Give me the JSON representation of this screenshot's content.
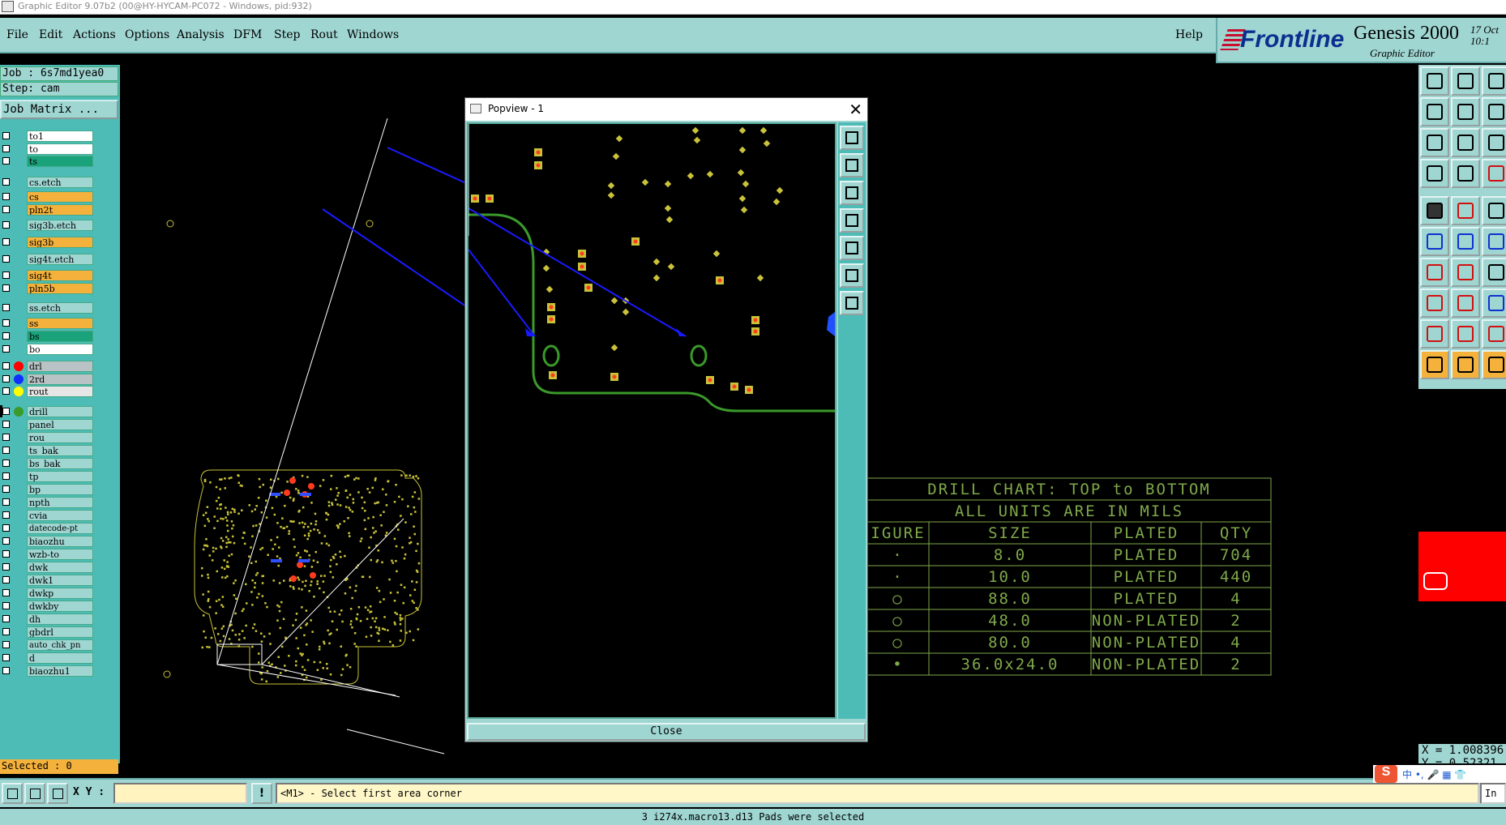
{
  "window_title": "Graphic Editor 9.07b2 (00@HY-HYCAM-PC072 - Windows, pid:932)",
  "menu": {
    "file": "File",
    "edit": "Edit",
    "actions": "Actions",
    "options": "Options",
    "analysis": "Analysis",
    "dfm": "DFM",
    "step": "Step",
    "rout": "Rout",
    "windows": "Windows",
    "help": "Help"
  },
  "brand": {
    "logo": "Frontline",
    "product": "Genesis 2000",
    "subtitle": "Graphic Editor",
    "date_line1": "17 Oct",
    "date_line2": "10:1"
  },
  "job": {
    "job_line": "Job : 6s7md1yea0",
    "step_line": "Step: cam",
    "job_matrix": "Job Matrix ..."
  },
  "layers": [
    {
      "name": "to1",
      "color": "#ffffff",
      "dot": ""
    },
    {
      "name": "to",
      "color": "#ffffff",
      "dot": ""
    },
    {
      "name": "ts",
      "color": "#1aa37a",
      "dot": ""
    },
    {
      "name": "cs.etch",
      "color": "#9fd6d2",
      "dot": ""
    },
    {
      "name": "cs",
      "color": "#f4b13c",
      "dot": ""
    },
    {
      "name": "pln2t",
      "color": "#f4b13c",
      "dot": ""
    },
    {
      "name": "sig3b.etch",
      "color": "#9fd6d2",
      "dot": ""
    },
    {
      "name": "sig3b",
      "color": "#f4b13c",
      "dot": ""
    },
    {
      "name": "sig4t.etch",
      "color": "#9fd6d2",
      "dot": ""
    },
    {
      "name": "sig4t",
      "color": "#f4b13c",
      "dot": ""
    },
    {
      "name": "pln5b",
      "color": "#f4b13c",
      "dot": ""
    },
    {
      "name": "ss.etch",
      "color": "#9fd6d2",
      "dot": ""
    },
    {
      "name": "ss",
      "color": "#f4b13c",
      "dot": ""
    },
    {
      "name": "bs",
      "color": "#1aa37a",
      "dot": ""
    },
    {
      "name": "bo",
      "color": "#ffffff",
      "dot": ""
    },
    {
      "name": "drl",
      "color": "#b9c3c5",
      "dot": "#ff0000"
    },
    {
      "name": "2rd",
      "color": "#b9c3c5",
      "dot": "#1030ff"
    },
    {
      "name": "rout",
      "color": "#e6e6e6",
      "dot": "#ffff00"
    },
    {
      "name": "drill",
      "color": "#9fd6d2",
      "dot": "#3a9a2a"
    },
    {
      "name": "panel",
      "color": "#9fd6d2",
      "dot": ""
    },
    {
      "name": "rou",
      "color": "#9fd6d2",
      "dot": ""
    },
    {
      "name": "ts_bak",
      "color": "#9fd6d2",
      "dot": ""
    },
    {
      "name": "bs_bak",
      "color": "#9fd6d2",
      "dot": ""
    },
    {
      "name": "tp",
      "color": "#9fd6d2",
      "dot": ""
    },
    {
      "name": "bp",
      "color": "#9fd6d2",
      "dot": ""
    },
    {
      "name": "npth",
      "color": "#9fd6d2",
      "dot": ""
    },
    {
      "name": "cvia",
      "color": "#9fd6d2",
      "dot": ""
    },
    {
      "name": "datecode-pt",
      "color": "#9fd6d2",
      "dot": ""
    },
    {
      "name": "biaozhu",
      "color": "#9fd6d2",
      "dot": ""
    },
    {
      "name": "wzb-to",
      "color": "#9fd6d2",
      "dot": ""
    },
    {
      "name": "dwk",
      "color": "#9fd6d2",
      "dot": ""
    },
    {
      "name": "dwk1",
      "color": "#9fd6d2",
      "dot": ""
    },
    {
      "name": "dwkp",
      "color": "#9fd6d2",
      "dot": ""
    },
    {
      "name": "dwkby",
      "color": "#9fd6d2",
      "dot": ""
    },
    {
      "name": "dh",
      "color": "#9fd6d2",
      "dot": ""
    },
    {
      "name": "gbdrl",
      "color": "#9fd6d2",
      "dot": ""
    },
    {
      "name": "auto_chk_pn",
      "color": "#9fd6d2",
      "dot": ""
    },
    {
      "name": "d",
      "color": "#9fd6d2",
      "dot": ""
    },
    {
      "name": "biaozhu1",
      "color": "#9fd6d2",
      "dot": ""
    }
  ],
  "selected_count": "Selected : 0",
  "drill_chart": {
    "title": "DRILL CHART: TOP to BOTTOM",
    "units": "ALL UNITS ARE IN MILS",
    "headers": [
      "IGURE",
      "SIZE",
      "PLATED",
      "QTY"
    ],
    "rows": [
      [
        "·",
        "8.0",
        "PLATED",
        "704"
      ],
      [
        "·",
        "10.0",
        "PLATED",
        "440"
      ],
      [
        "○",
        "88.0",
        "PLATED",
        "4"
      ],
      [
        "○",
        "48.0",
        "NON-PLATED",
        "2"
      ],
      [
        "○",
        "80.0",
        "NON-PLATED",
        "4"
      ],
      [
        "•",
        "36.0x24.0",
        "NON-PLATED",
        "2"
      ]
    ]
  },
  "popup": {
    "title": "Popview - 1",
    "close_label": "Close"
  },
  "coord_readout": "X = 1.008396\nY = 0.52321",
  "bottom": {
    "xy_label": "X Y :",
    "xy_value": "",
    "info_button": "!",
    "message": "<M1> - Select first area corner",
    "right_btn": "In"
  },
  "status": "3 i274x.macro13.d13 Pads were selected",
  "ime": {
    "logo": "S",
    "text": "中 •, 🎤 ▦ 👕"
  },
  "colors": {
    "panel": "#9fd6d2",
    "panel_dark": "#4dbcb6",
    "pad_yellow": "#c9c23a",
    "pad_red": "#ff3b1e",
    "outline_green": "#3a9a2a",
    "arrow_blue": "#1a1aff",
    "chart_green": "#7fa84a"
  }
}
